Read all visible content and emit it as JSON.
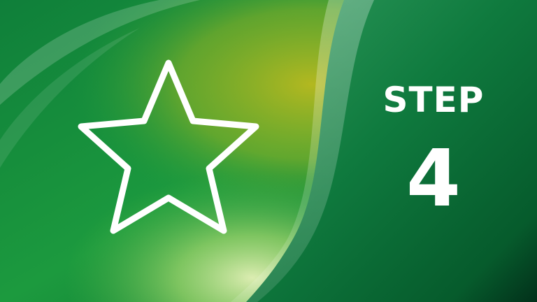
{
  "slide": {
    "step_label": "STEP",
    "step_number": "4",
    "icon": "star-outline-icon"
  },
  "colors": {
    "dark_green": "#0a6a34",
    "mid_green": "#1f9a3c",
    "lime": "#a8b820",
    "light_green": "#8fd05a",
    "text": "#ffffff"
  }
}
